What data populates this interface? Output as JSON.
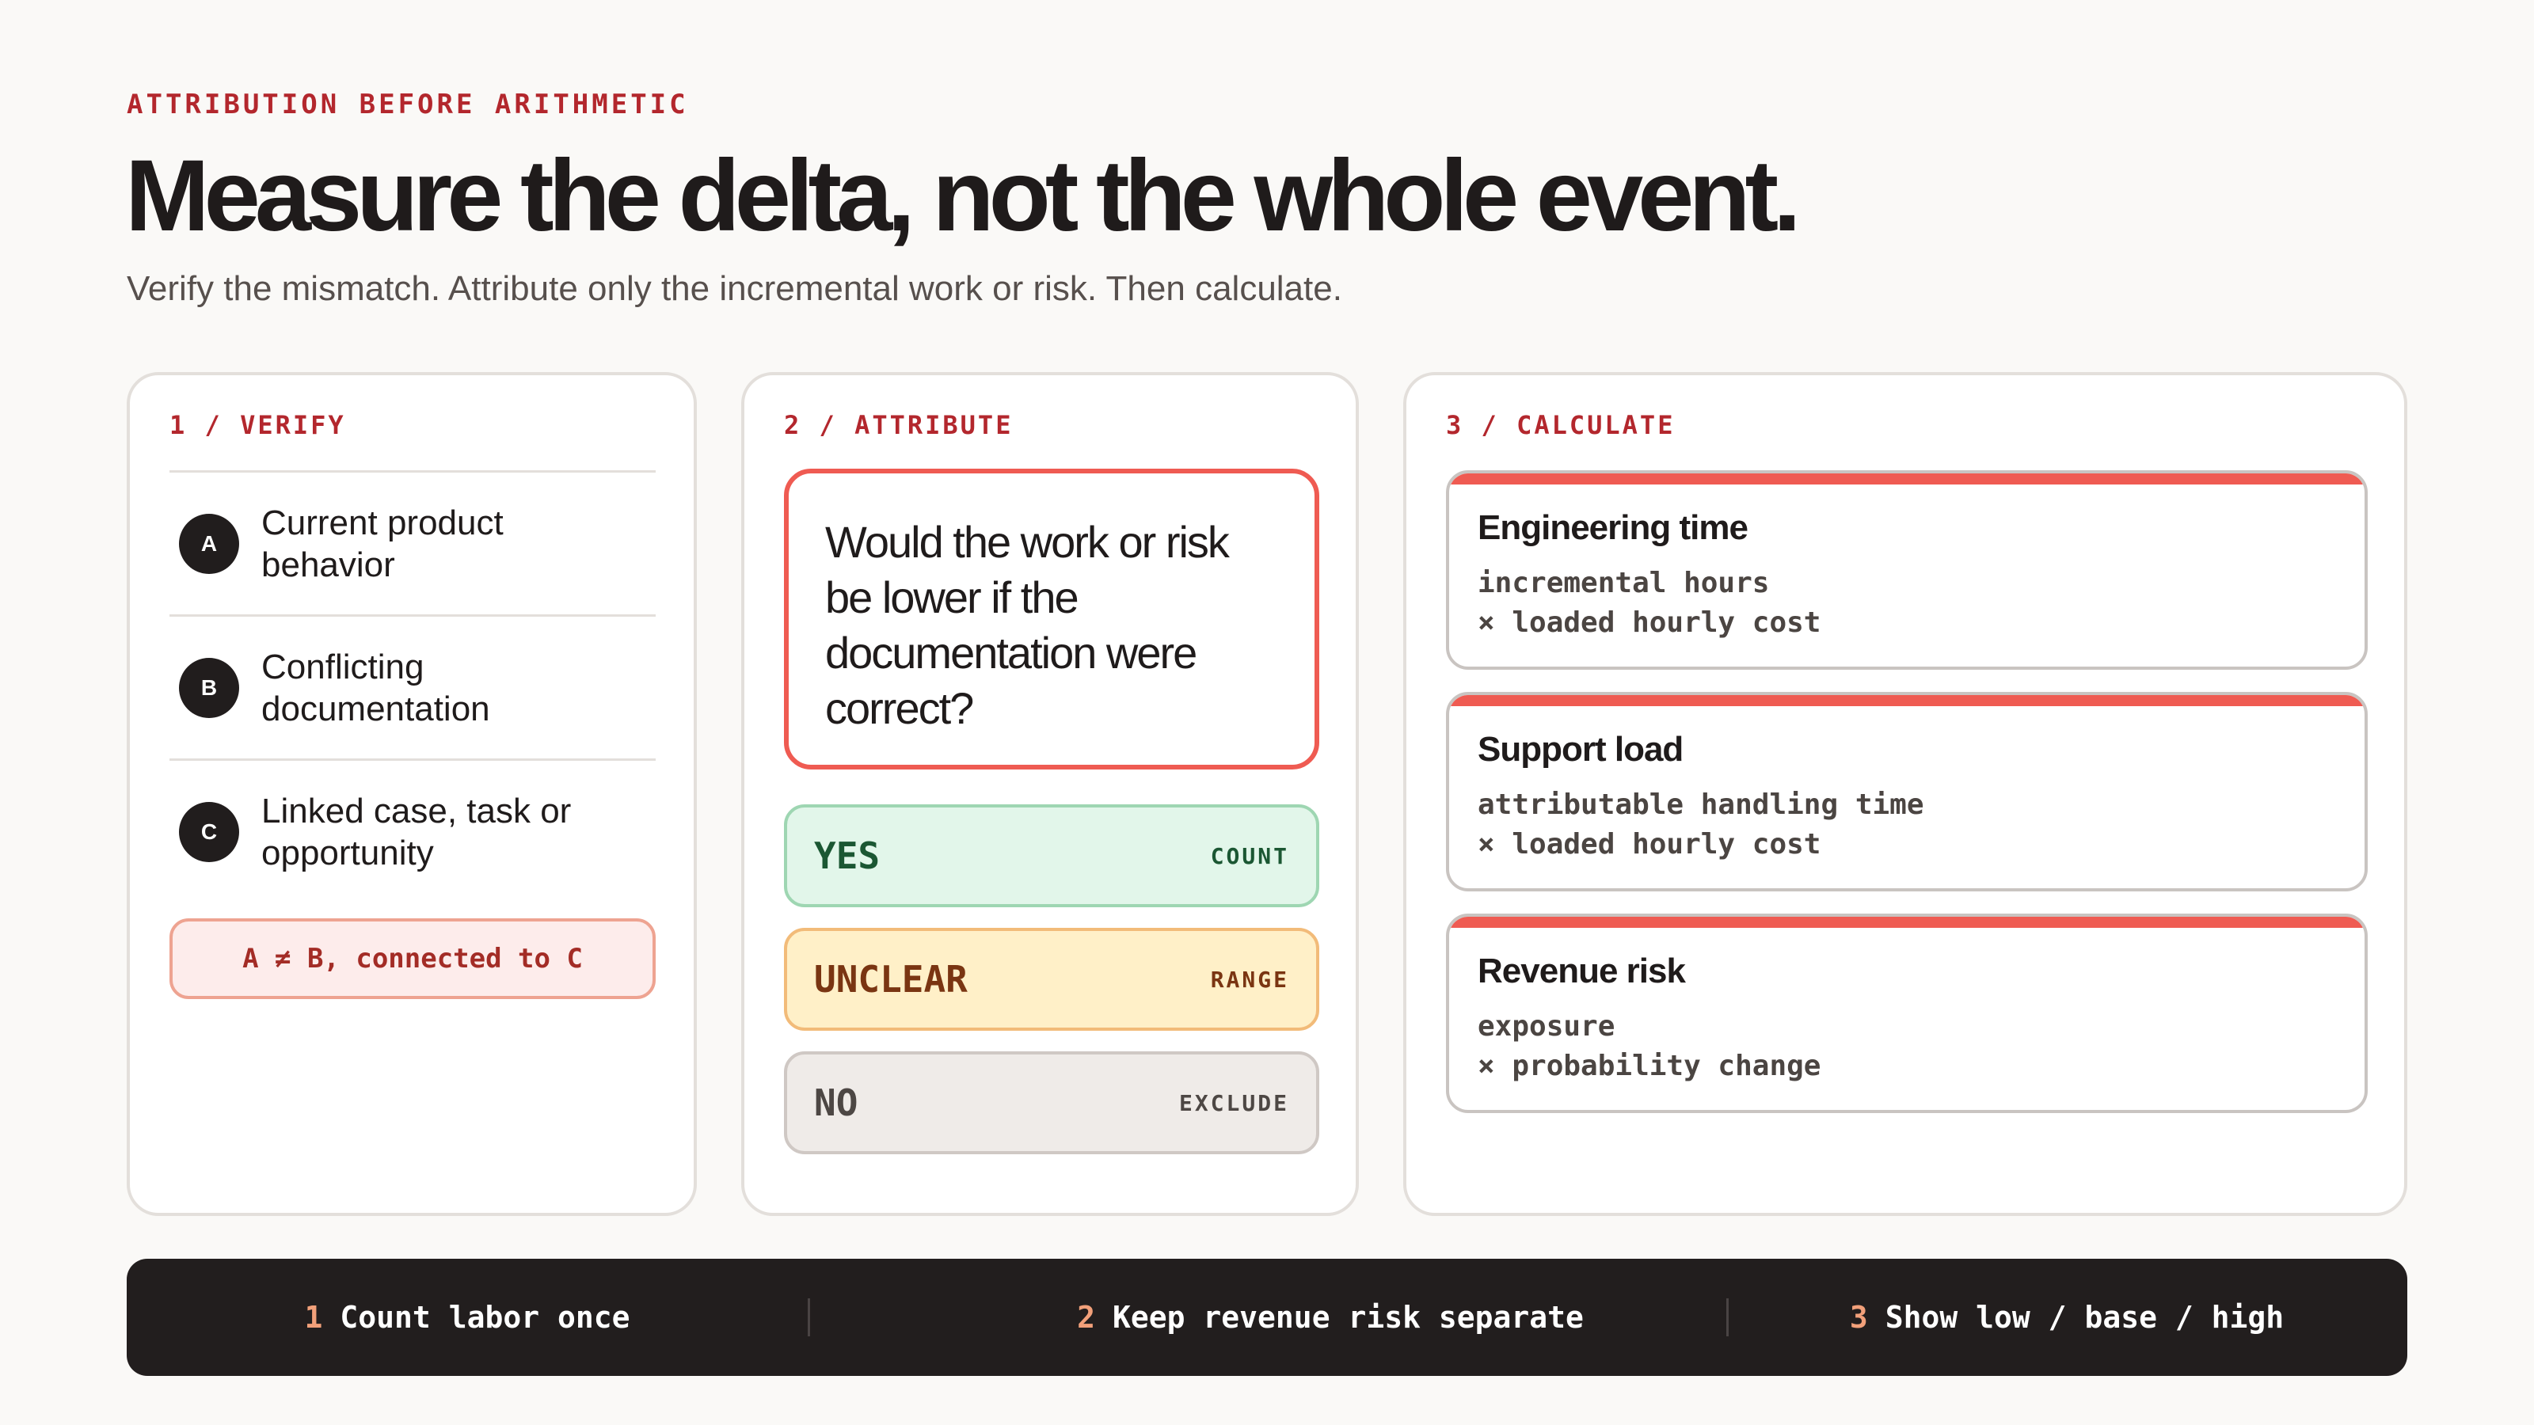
{
  "eyebrow": "ATTRIBUTION BEFORE ARITHMETIC",
  "title": "Measure the delta, not the whole event.",
  "subtitle": "Verify the mismatch. Attribute only the incremental work or risk. Then calculate.",
  "colors": {
    "accent": "#b3272d",
    "highlight": "#ef5b52",
    "dark": "#221e1e",
    "yes": "#e2f6ea",
    "unclear": "#fff0c8",
    "no": "#efebe8"
  },
  "verify": {
    "heading": "1 / VERIFY",
    "items": [
      {
        "badge": "A",
        "text": "Current product behavior"
      },
      {
        "badge": "B",
        "text": "Conflicting documentation"
      },
      {
        "badge": "C",
        "text": "Linked case, task or opportunity"
      }
    ],
    "rule": "A ≠ B, connected to C"
  },
  "attribute": {
    "heading": "2 / ATTRIBUTE",
    "question": "Would the work or risk be lower if the documentation were correct?",
    "options": [
      {
        "label": "YES",
        "tag": "COUNT"
      },
      {
        "label": "UNCLEAR",
        "tag": "RANGE"
      },
      {
        "label": "NO",
        "tag": "EXCLUDE"
      }
    ]
  },
  "calculate": {
    "heading": "3 / CALCULATE",
    "cards": [
      {
        "title": "Engineering time",
        "line1": "incremental hours",
        "line2": "× loaded hourly cost"
      },
      {
        "title": "Support load",
        "line1": "attributable handling time",
        "line2": "× loaded hourly cost"
      },
      {
        "title": "Revenue risk",
        "line1": "exposure",
        "line2": "× probability change"
      }
    ]
  },
  "footer": [
    {
      "num": "1",
      "text": "Count labor once"
    },
    {
      "num": "2",
      "text": "Keep revenue risk separate"
    },
    {
      "num": "3",
      "text": "Show low / base / high"
    }
  ]
}
